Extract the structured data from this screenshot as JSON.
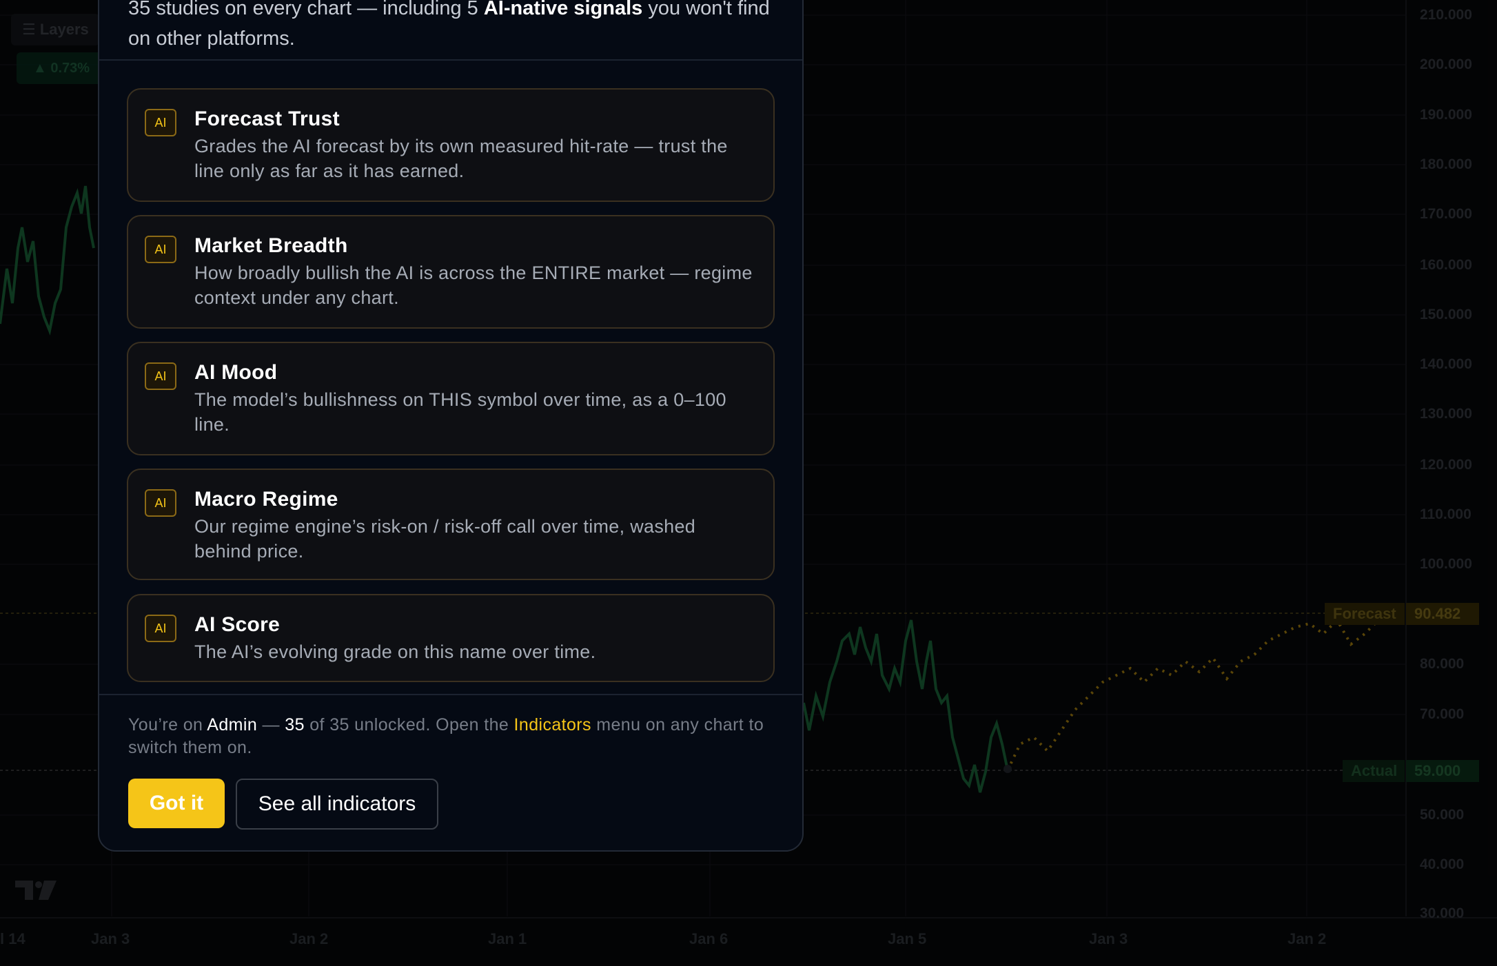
{
  "toolbar": {
    "layers_label": "☰ Layers",
    "change_badge": "▲ 0.73%"
  },
  "chart": {
    "y_ticks": [
      "210.000",
      "200.000",
      "190.000",
      "180.000",
      "170.000",
      "160.000",
      "150.000",
      "140.000",
      "130.000",
      "120.000",
      "110.000",
      "100.000",
      "80.000",
      "70.000",
      "50.000",
      "40.000",
      "30.000"
    ],
    "x_ticks": [
      "l 14",
      "Jan 3",
      "Jan 2",
      "Jan 1",
      "Jan 6",
      "Jan 5",
      "Jan 3",
      "Jan 2"
    ],
    "forecast": {
      "label": "Forecast",
      "value": "90.482",
      "color": "#f5c518"
    },
    "actual": {
      "label": "Actual",
      "value": "59.000",
      "color": "#22c55e"
    }
  },
  "modal": {
    "intro_prefix": "35 studies on every chart — including 5 ",
    "intro_bold": "AI-native signals",
    "intro_suffix": " you won't find on other platforms.",
    "cards": [
      {
        "badge": "AI",
        "title": "Forecast Trust",
        "desc": "Grades the AI forecast by its own measured hit-rate — trust the line only as far as it has earned."
      },
      {
        "badge": "AI",
        "title": "Market Breadth",
        "desc": "How broadly bullish the AI is across the ENTIRE market — regime context under any chart."
      },
      {
        "badge": "AI",
        "title": "AI Mood",
        "desc": "The model’s bullishness on THIS symbol over time, as a 0–100 line."
      },
      {
        "badge": "AI",
        "title": "Macro Regime",
        "desc": "Our regime engine’s risk-on / risk-off call over time, washed behind price."
      },
      {
        "badge": "AI",
        "title": "AI Score",
        "desc": "The AI’s evolving grade on this name over time."
      }
    ],
    "footer": {
      "t1": "You’re on ",
      "plan": "Admin",
      "t2": " — ",
      "count": "35",
      "t3": " of 35 unlocked. Open the ",
      "menu": "Indicators",
      "t4": " menu on any chart to switch them on."
    },
    "primary_button": "Got it",
    "secondary_button": "See all indicators"
  },
  "colors": {
    "accent": "#f5c518",
    "positive": "#22c55e",
    "modal_bg": "#050a14"
  }
}
